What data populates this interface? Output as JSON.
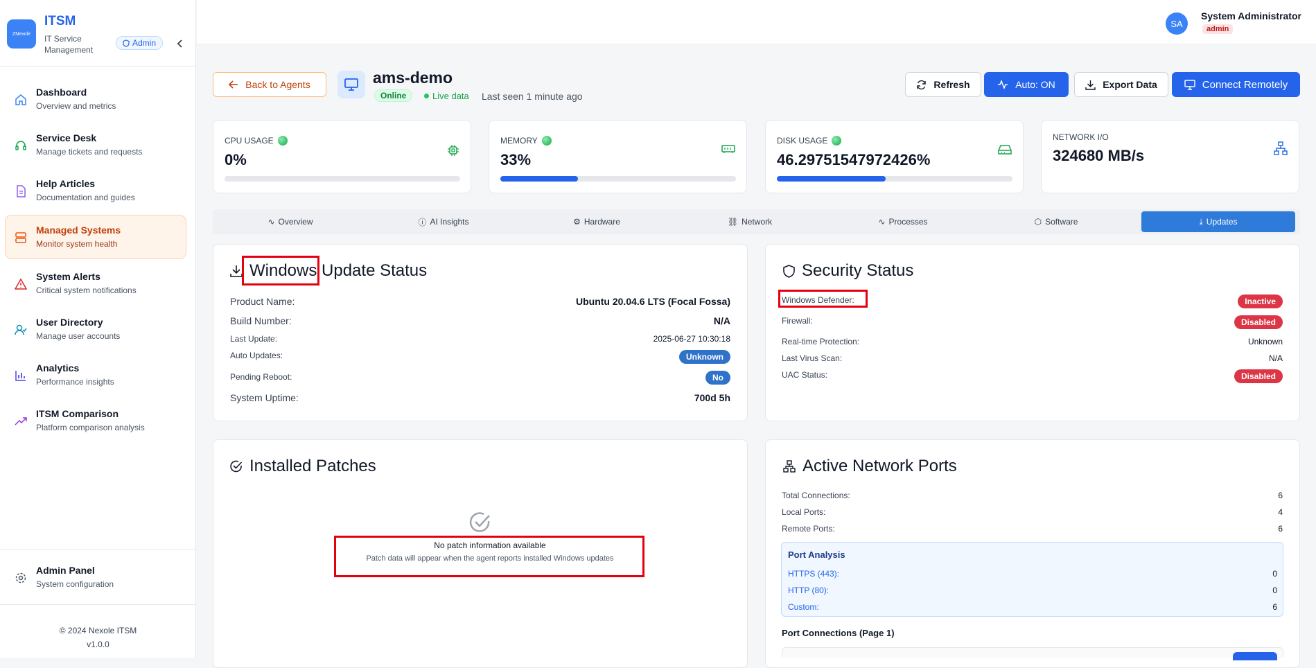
{
  "sidebar": {
    "logo_text": "ZNexole",
    "brand_title": "ITSM",
    "brand_subtitle": "IT Service Management",
    "admin_badge": "Admin",
    "nav": [
      {
        "title": "Dashboard",
        "subtitle": "Overview and metrics",
        "icon": "home-icon"
      },
      {
        "title": "Service Desk",
        "subtitle": "Manage tickets and requests",
        "icon": "headset-icon"
      },
      {
        "title": "Help Articles",
        "subtitle": "Documentation and guides",
        "icon": "document-icon"
      },
      {
        "title": "Managed Systems",
        "subtitle": "Monitor system health",
        "icon": "server-icon",
        "active": true
      },
      {
        "title": "System Alerts",
        "subtitle": "Critical system notifications",
        "icon": "warning-icon"
      },
      {
        "title": "User Directory",
        "subtitle": "Manage user accounts",
        "icon": "users-icon"
      },
      {
        "title": "Analytics",
        "subtitle": "Performance insights",
        "icon": "bar-chart-icon"
      },
      {
        "title": "ITSM Comparison",
        "subtitle": "Platform comparison analysis",
        "icon": "trend-icon"
      }
    ],
    "admin_panel": {
      "title": "Admin Panel",
      "subtitle": "System configuration"
    },
    "copyright": "© 2024 Nexole ITSM",
    "version": "v1.0.0"
  },
  "user": {
    "initials": "SA",
    "name": "System Administrator",
    "role": "admin"
  },
  "header": {
    "back_label": "Back to Agents",
    "agent_name": "ams-demo",
    "status": "Online",
    "live": "Live data",
    "last_seen": "Last seen 1 minute ago",
    "refresh": "Refresh",
    "auto": "Auto: ON",
    "export": "Export Data",
    "connect": "Connect Remotely"
  },
  "metrics": {
    "cpu": {
      "label": "CPU USAGE",
      "value": "0%",
      "percent": 0
    },
    "memory": {
      "label": "MEMORY",
      "value": "33%",
      "percent": 33
    },
    "disk": {
      "label": "DISK USAGE",
      "value": "46.29751547972426%",
      "percent": 46.3
    },
    "network": {
      "label": "NETWORK I/O",
      "value": "324680 MB/s"
    }
  },
  "tabs": [
    "Overview",
    "AI Insights",
    "Hardware",
    "Network",
    "Processes",
    "Software",
    "Updates"
  ],
  "active_tab": "Updates",
  "update_status": {
    "title_1": "Windows",
    "title_2": " Update Status",
    "rows": [
      {
        "label": "Product Name:",
        "value": "Ubuntu 20.04.6 LTS (Focal Fossa)"
      },
      {
        "label": "Build Number:",
        "value": "N/A"
      },
      {
        "label": "Last Update:",
        "value": "2025-06-27 10:30:18"
      },
      {
        "label": "Auto Updates:",
        "value": "Unknown"
      },
      {
        "label": "Pending Reboot:",
        "value": "No"
      },
      {
        "label": "System Uptime:",
        "value": "700d 5h"
      }
    ]
  },
  "security": {
    "title": "Security Status",
    "rows": [
      {
        "label": "Windows Defender:",
        "value": "Inactive"
      },
      {
        "label": "Firewall:",
        "value": "Disabled"
      },
      {
        "label": "Real-time Protection:",
        "value": "Unknown"
      },
      {
        "label": "Last Virus Scan:",
        "value": "N/A"
      },
      {
        "label": "UAC Status:",
        "value": "Disabled"
      }
    ]
  },
  "patches": {
    "title": "Installed Patches",
    "empty_title": "No patch information available",
    "empty_desc": "Patch data will appear when the agent reports installed Windows updates"
  },
  "ports": {
    "title": "Active Network Ports",
    "rows": [
      {
        "label": "Total Connections:",
        "value": "6"
      },
      {
        "label": "Local Ports:",
        "value": "4"
      },
      {
        "label": "Remote Ports:",
        "value": "6"
      }
    ],
    "analysis_title": "Port Analysis",
    "analysis": [
      {
        "label": "HTTPS (443):",
        "value": "0"
      },
      {
        "label": "HTTP (80):",
        "value": "0"
      },
      {
        "label": "Custom:",
        "value": "6"
      }
    ],
    "connections_title": "Port Connections (Page 1)"
  },
  "colors": {
    "accent": "#2563eb",
    "active_nav": "#c2410c",
    "danger": "#dc3545",
    "success": "#16a34a"
  }
}
